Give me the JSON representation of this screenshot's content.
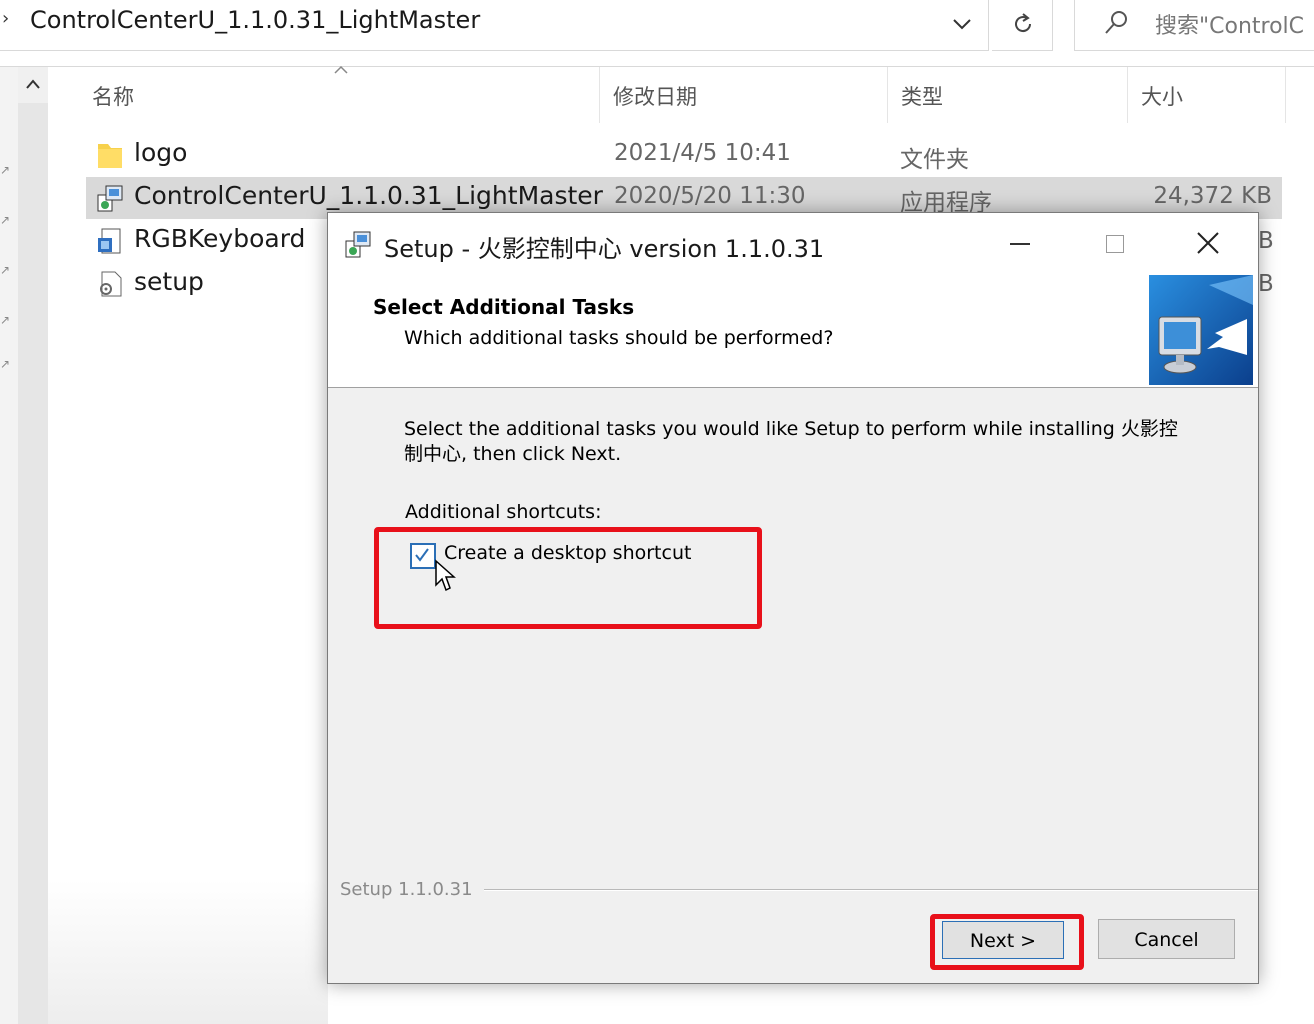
{
  "address_bar": {
    "path": "ControlCenterU_1.1.0.31_LightMaster",
    "search_placeholder": "搜索\"ControlC"
  },
  "columns": {
    "name": "名称",
    "date": "修改日期",
    "type": "类型",
    "size": "大小"
  },
  "files": [
    {
      "name": "logo",
      "date": "2021/4/5 10:41",
      "type": "文件夹",
      "size": "",
      "icon": "folder-icon"
    },
    {
      "name": "ControlCenterU_1.1.0.31_LightMaster",
      "date": "2020/5/20 11:30",
      "type": "应用程序",
      "size": "24,372 KB",
      "icon": "installer-icon",
      "selected": true
    },
    {
      "name": "RGBKeyboard",
      "icon": "setup-file-icon"
    },
    {
      "name": "setup",
      "icon": "config-file-icon"
    }
  ],
  "peek_sizes": [
    "B",
    "B"
  ],
  "dialog": {
    "title": "Setup - 火影控制中心 version 1.1.0.31",
    "header_title": "Select Additional Tasks",
    "header_subtitle": "Which additional tasks should be performed?",
    "body_text": "Select the additional tasks you would like Setup to perform while installing 火影控制中心, then click Next.",
    "shortcuts_label": "Additional shortcuts:",
    "checkbox_label": "Create a desktop shortcut",
    "checkbox_checked": true,
    "version_label": "Setup 1.1.0.31",
    "next_label": "Next >",
    "cancel_label": "Cancel"
  },
  "colors": {
    "highlight": "#e8101a",
    "accent": "#2b6fb6",
    "dialog_bg": "#f0f0f0",
    "selected_row": "#d9d9d9"
  }
}
